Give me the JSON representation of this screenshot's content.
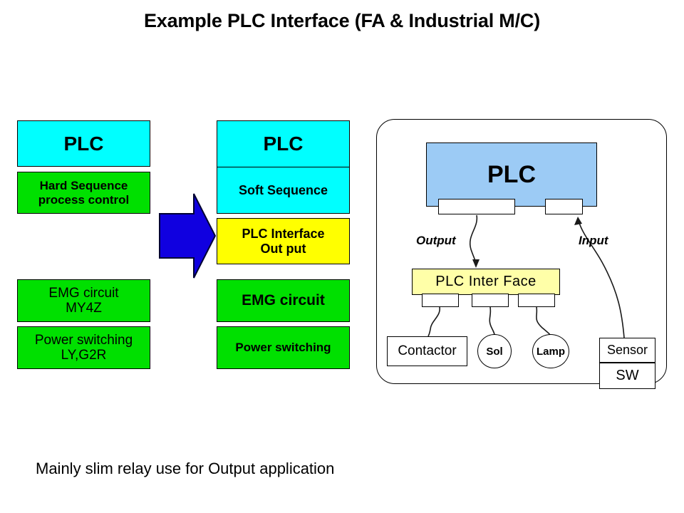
{
  "title": "Example PLC Interface (FA & Industrial M/C)",
  "caption": "Mainly slim relay use for Output application",
  "colors": {
    "cyan": "#00FFFF",
    "green": "#00E000",
    "yellow": "#FFFF00",
    "pale_yellow": "#FFFFA8",
    "plc_blue": "#9CCBF5",
    "arrow_blue": "#1000E0",
    "outline": "#000000"
  },
  "left_column": {
    "plc": "PLC",
    "hard_sequence": "Hard Sequence\nprocess control",
    "hard_sequence_line1": "Hard Sequence",
    "hard_sequence_line2": "process  control",
    "emg_line1": "EMG circuit",
    "emg_line2": "MY4Z",
    "power_line1": "Power switching",
    "power_line2": "LY,G2R"
  },
  "arrow": {
    "name": "right-arrow",
    "direction": "right",
    "color": "#1000E0"
  },
  "middle_column": {
    "plc": "PLC",
    "soft_sequence": "Soft Sequence",
    "interface_line1": "PLC Interface",
    "interface_line2": "Out put",
    "emg": "EMG circuit",
    "power": "Power switching"
  },
  "right_panel": {
    "plc": "PLC",
    "output_label": "Output",
    "input_label": "Input",
    "interface": "PLC Inter Face",
    "devices": {
      "contactor": "Contactor",
      "sol": "Sol",
      "lamp": "Lamp",
      "sensor": "Sensor",
      "sw": "SW"
    },
    "terminals": {
      "output_terminal": "",
      "input_terminal": "",
      "iface_terminal_1": "",
      "iface_terminal_2": "",
      "iface_terminal_3": ""
    }
  }
}
